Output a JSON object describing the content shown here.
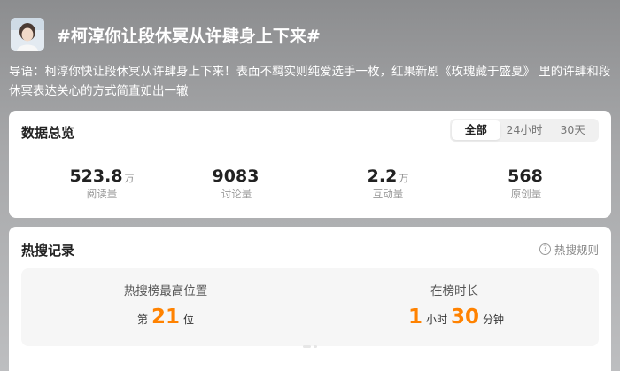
{
  "topic": {
    "title": "#柯淳你让段休冥从许肆身上下来#",
    "intro": "导语：柯淳你快让段休冥从许肆身上下来！表面不羁实则纯爱选手一枚，红果新剧《玫瑰藏于盛夏》 里的许肆和段休冥表达关心的方式简直如出一辙"
  },
  "overview": {
    "title": "数据总览",
    "tabs": [
      {
        "label": "全部",
        "active": true
      },
      {
        "label": "24小时",
        "active": false
      },
      {
        "label": "30天",
        "active": false
      }
    ],
    "stats": [
      {
        "value": "523.8",
        "unit": "万",
        "label": "阅读量"
      },
      {
        "value": "9083",
        "unit": "",
        "label": "讨论量"
      },
      {
        "value": "2.2",
        "unit": "万",
        "label": "互动量"
      },
      {
        "value": "568",
        "unit": "",
        "label": "原创量"
      }
    ]
  },
  "hot": {
    "title": "热搜记录",
    "rule_label": "热搜规则",
    "rule_icon": "question-circle-icon",
    "best_label": "热搜榜最高位置",
    "best_prefix": "第",
    "best_value": "21",
    "best_suffix": "位",
    "duration_label": "在榜时长",
    "duration_hours": "1",
    "duration_hours_unit": "小时",
    "duration_minutes": "30",
    "duration_minutes_unit": "分钟"
  },
  "colors": {
    "accent": "#ff8200",
    "card_bg": "#ffffff",
    "muted": "#999999"
  }
}
